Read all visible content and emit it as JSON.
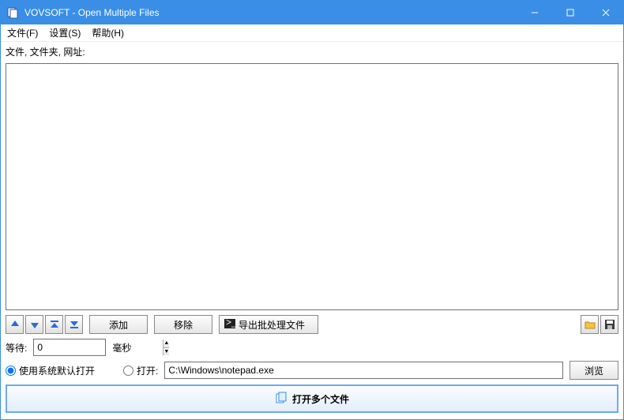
{
  "titlebar": {
    "title": "VOVSOFT - Open Multiple Files"
  },
  "menu": {
    "file": "文件(F)",
    "settings": "设置(S)",
    "help": "帮助(H)"
  },
  "labels": {
    "list_caption": "文件, 文件夹, 网址:",
    "wait": "等待:",
    "ms": "毫秒"
  },
  "buttons": {
    "add": "添加",
    "remove": "移除",
    "export_batch": "导出批处理文件",
    "browse": "浏览",
    "open_multiple": "打开多个文件"
  },
  "radios": {
    "use_default": "使用系统默认打开",
    "open_with": "打开:"
  },
  "inputs": {
    "wait_value": "0",
    "open_path": "C:\\Windows\\notepad.exe"
  }
}
